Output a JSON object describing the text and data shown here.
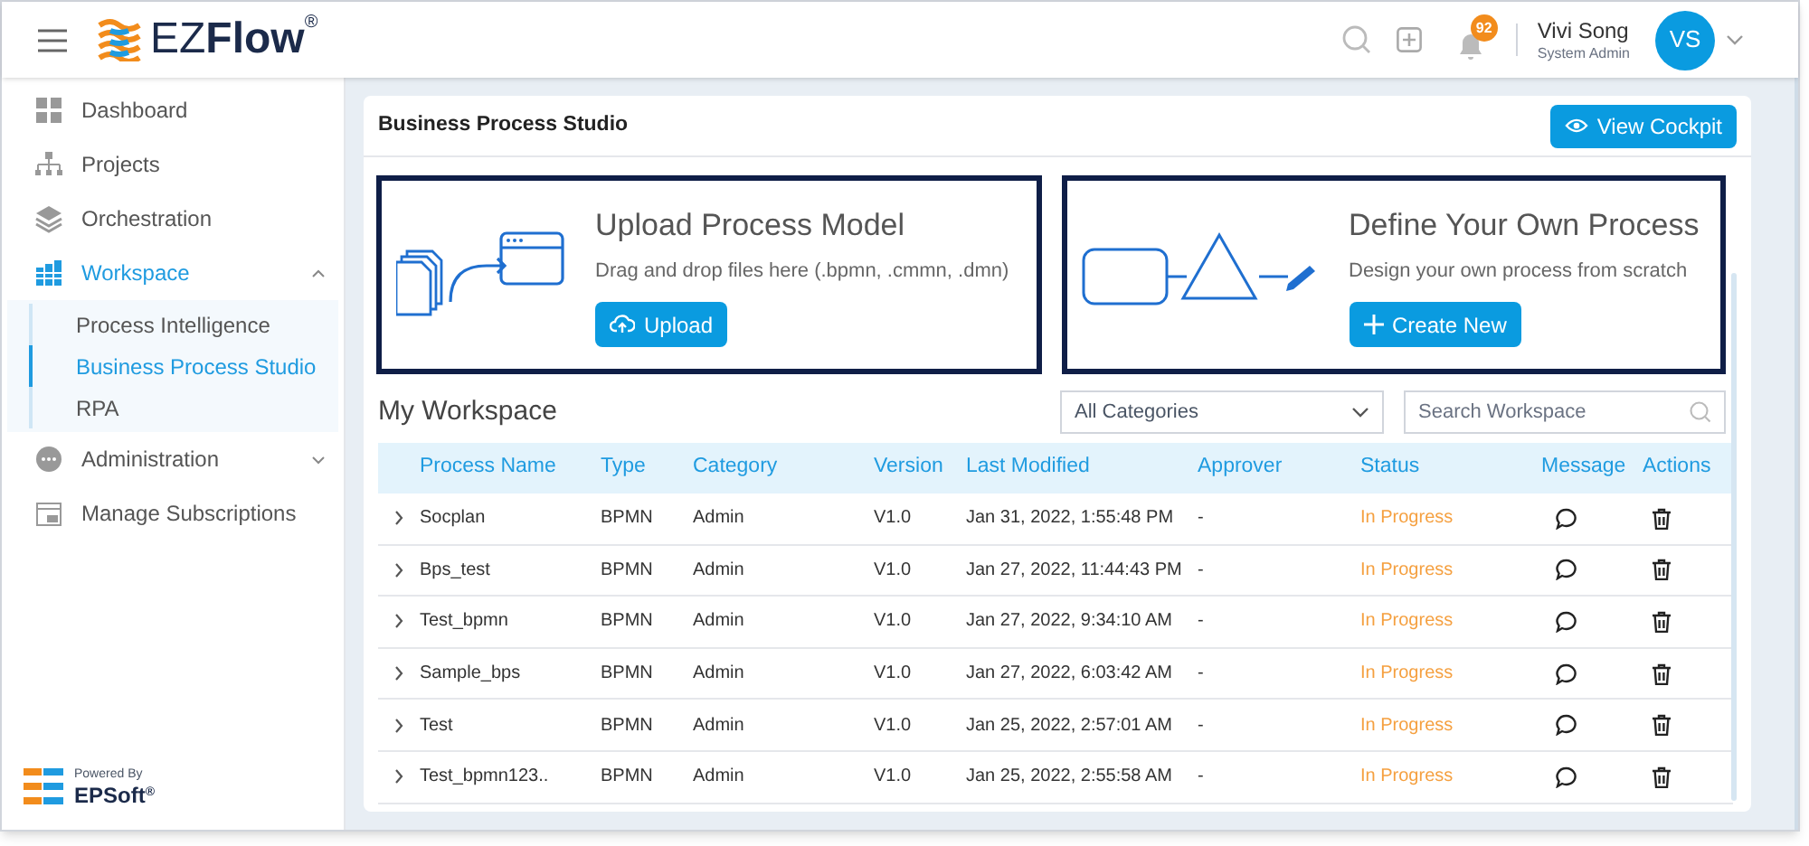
{
  "header": {
    "logo": {
      "name": "EZ",
      "bold": "Flow",
      "mark": "®"
    },
    "notifications": "92",
    "user": {
      "name": "Vivi Song",
      "role": "System Admin",
      "initials": "VS"
    }
  },
  "sidebar": {
    "items": [
      {
        "label": "Dashboard",
        "selected": false
      },
      {
        "label": "Projects",
        "selected": false
      },
      {
        "label": "Orchestration",
        "selected": false
      },
      {
        "label": "Workspace",
        "selected": true,
        "expanded": true,
        "children": [
          {
            "label": "Process Intelligence",
            "selected": false
          },
          {
            "label": "Business Process Studio",
            "selected": true
          },
          {
            "label": "RPA",
            "selected": false
          }
        ]
      },
      {
        "label": "Administration",
        "selected": false,
        "expanded": false
      },
      {
        "label": "Manage Subscriptions",
        "selected": false
      }
    ],
    "footer": {
      "caption": "Powered By",
      "brand": "EPSoft",
      "mark": "®"
    }
  },
  "page": {
    "title": "Business Process Studio",
    "action": "View Cockpit",
    "cards": [
      {
        "kind": "upload",
        "title": "Upload Process Model",
        "text": "Drag and drop files here (.bpmn, .cmmn, .dmn)",
        "button": "Upload"
      },
      {
        "kind": "define",
        "title": "Define Your Own Process",
        "text": "Design your own process from scratch",
        "button": "Create New"
      }
    ],
    "workspace": {
      "title": "My Workspace",
      "category_filter": "All Categories",
      "search": {
        "placeholder": "Search Workspace"
      },
      "columns": [
        "Process Name",
        "Type",
        "Category",
        "Version",
        "Last Modified",
        "Approver",
        "Status",
        "Message",
        "Actions"
      ],
      "rows": [
        {
          "name": "Socplan",
          "type": "BPMN",
          "category": "Admin",
          "version": "V1.0",
          "modified": "Jan 31, 2022, 1:55:48 PM",
          "approver": "-",
          "status": "In Progress"
        },
        {
          "name": "Bps_test",
          "type": "BPMN",
          "category": "Admin",
          "version": "V1.0",
          "modified": "Jan 27, 2022, 11:44:43 PM",
          "approver": "-",
          "status": "In Progress"
        },
        {
          "name": "Test_bpmn",
          "type": "BPMN",
          "category": "Admin",
          "version": "V1.0",
          "modified": "Jan 27, 2022, 9:34:10 AM",
          "approver": "-",
          "status": "In Progress"
        },
        {
          "name": "Sample_bps",
          "type": "BPMN",
          "category": "Admin",
          "version": "V1.0",
          "modified": "Jan 27, 2022, 6:03:42 AM",
          "approver": "-",
          "status": "In Progress"
        },
        {
          "name": "Test",
          "type": "BPMN",
          "category": "Admin",
          "version": "V1.0",
          "modified": "Jan 25, 2022, 2:57:01 AM",
          "approver": "-",
          "status": "In Progress"
        },
        {
          "name": "Test_bpmn123..",
          "type": "BPMN",
          "category": "Admin",
          "version": "V1.0",
          "modified": "Jan 25, 2022, 2:55:58 AM",
          "approver": "-",
          "status": "In Progress"
        }
      ]
    }
  }
}
